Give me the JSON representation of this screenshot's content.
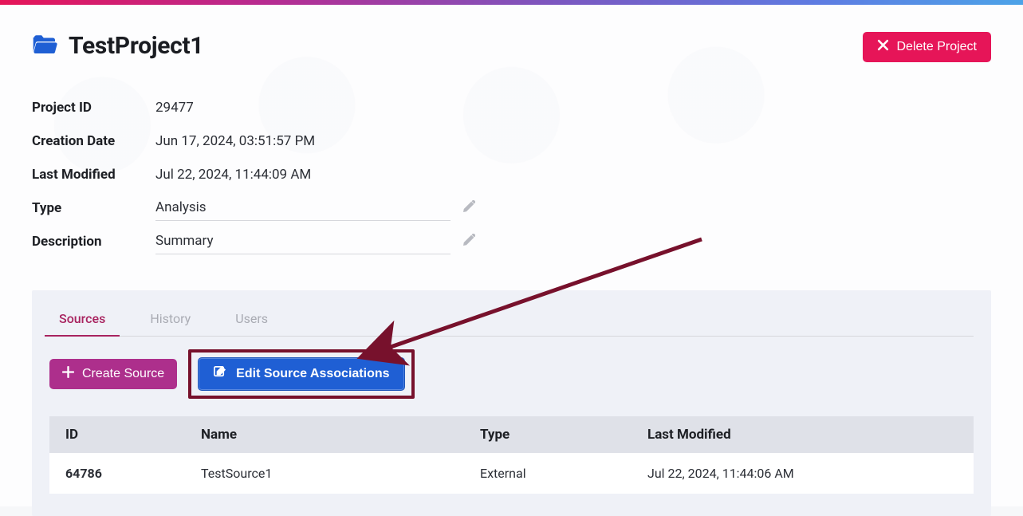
{
  "header": {
    "project_name": "TestProject1",
    "delete_label": "Delete Project"
  },
  "meta": {
    "project_id_label": "Project ID",
    "project_id": "29477",
    "creation_label": "Creation Date",
    "creation": "Jun 17, 2024, 03:51:57 PM",
    "modified_label": "Last Modified",
    "modified": "Jul 22, 2024, 11:44:09 AM",
    "type_label": "Type",
    "type": "Analysis",
    "description_label": "Description",
    "description": "Summary"
  },
  "tabs": {
    "sources": "Sources",
    "history": "History",
    "users": "Users"
  },
  "actions": {
    "create_source": "Create Source",
    "edit_assoc": "Edit Source Associations"
  },
  "table": {
    "headers": {
      "id": "ID",
      "name": "Name",
      "type": "Type",
      "modified": "Last Modified"
    },
    "rows": [
      {
        "id": "64786",
        "name": "TestSource1",
        "type": "External",
        "modified": "Jul 22, 2024, 11:44:06 AM"
      }
    ]
  }
}
